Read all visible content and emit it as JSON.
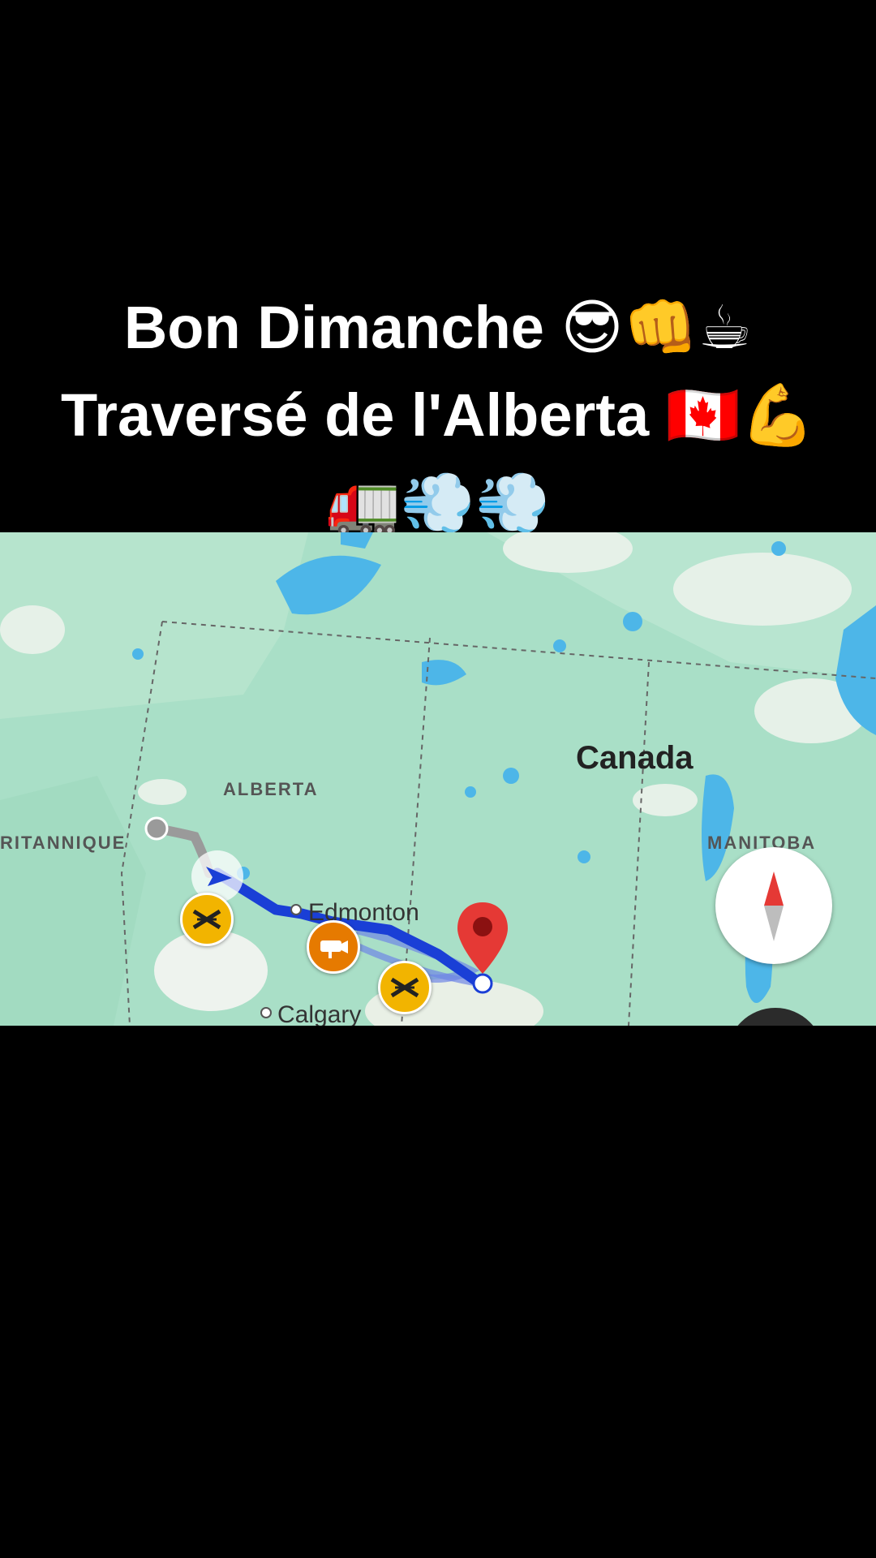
{
  "caption": {
    "line1": "Bon Dimanche 😎👊☕",
    "line2": "Traversé de l'Alberta 🇨🇦💪",
    "line3": "🚛💨💨"
  },
  "map": {
    "country_label": "Canada",
    "province_labels": {
      "alberta": "ALBERTA",
      "bc": "RITANNIQUE",
      "manitoba": "MANITOBA"
    },
    "cities": {
      "edmonton": "Edmonton",
      "calgary": "Calgary"
    },
    "colors": {
      "land": "#a9dfc7",
      "water": "#4db6e8",
      "route": "#1a3fd6",
      "destination_pin": "#e53935",
      "rail_marker": "#f2b400",
      "camera_marker": "#e67a00"
    },
    "icons": [
      "navigation-arrow-icon",
      "destination-pin-icon",
      "railway-crossing-icon",
      "speed-camera-icon",
      "compass-icon"
    ]
  }
}
